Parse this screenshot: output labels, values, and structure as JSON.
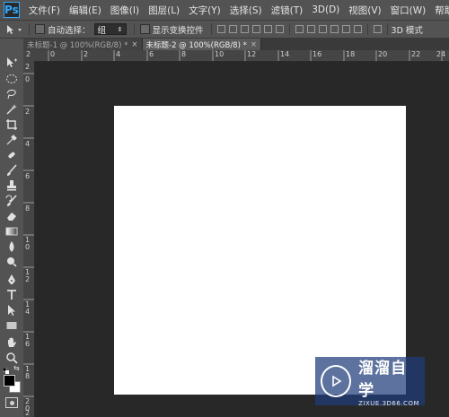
{
  "app": {
    "logo": "Ps"
  },
  "menu": [
    "文件(F)",
    "编辑(E)",
    "图像(I)",
    "图层(L)",
    "文字(Y)",
    "选择(S)",
    "滤镜(T)",
    "3D(D)",
    "视图(V)",
    "窗口(W)",
    "帮助(H)"
  ],
  "options": {
    "auto_select_label": "自动选择：",
    "auto_select_value": "组",
    "show_transform_label": "显示变换控件",
    "mode_3d_label": "3D 模式"
  },
  "tabs": [
    {
      "label": "未标题-1 @ 100%(RGB/8) *",
      "close": "×"
    },
    {
      "label": "未标题-2 @ 100%(RGB/8) *",
      "close": "×"
    }
  ],
  "ruler": {
    "top": [
      "2",
      "0",
      "2",
      "4",
      "6",
      "8",
      "10",
      "12",
      "14",
      "16",
      "18",
      "20",
      "22",
      "24"
    ],
    "left": [
      "2",
      "0",
      "2",
      "4",
      "6",
      "8",
      "1 0",
      "1 2",
      "1 4",
      "1 6",
      "1 8",
      "2 0",
      "2"
    ]
  },
  "tools": [
    "move-icon",
    "elliptical-marquee-icon",
    "lasso-icon",
    "magic-wand-icon",
    "crop-icon",
    "eyedropper-icon",
    "spot-healing-icon",
    "brush-icon",
    "clone-stamp-icon",
    "history-brush-icon",
    "eraser-icon",
    "gradient-icon",
    "blur-icon",
    "dodge-icon",
    "pen-icon",
    "type-icon",
    "path-selection-icon",
    "rectangle-icon",
    "hand-icon",
    "zoom-icon"
  ],
  "colors": {
    "foreground": "#000000",
    "background": "#ffffff",
    "canvas": "#ffffff",
    "accent": "#31a8ff"
  },
  "watermark": {
    "title": "溜溜自学",
    "url": "ZIXUE.3D66.COM"
  }
}
